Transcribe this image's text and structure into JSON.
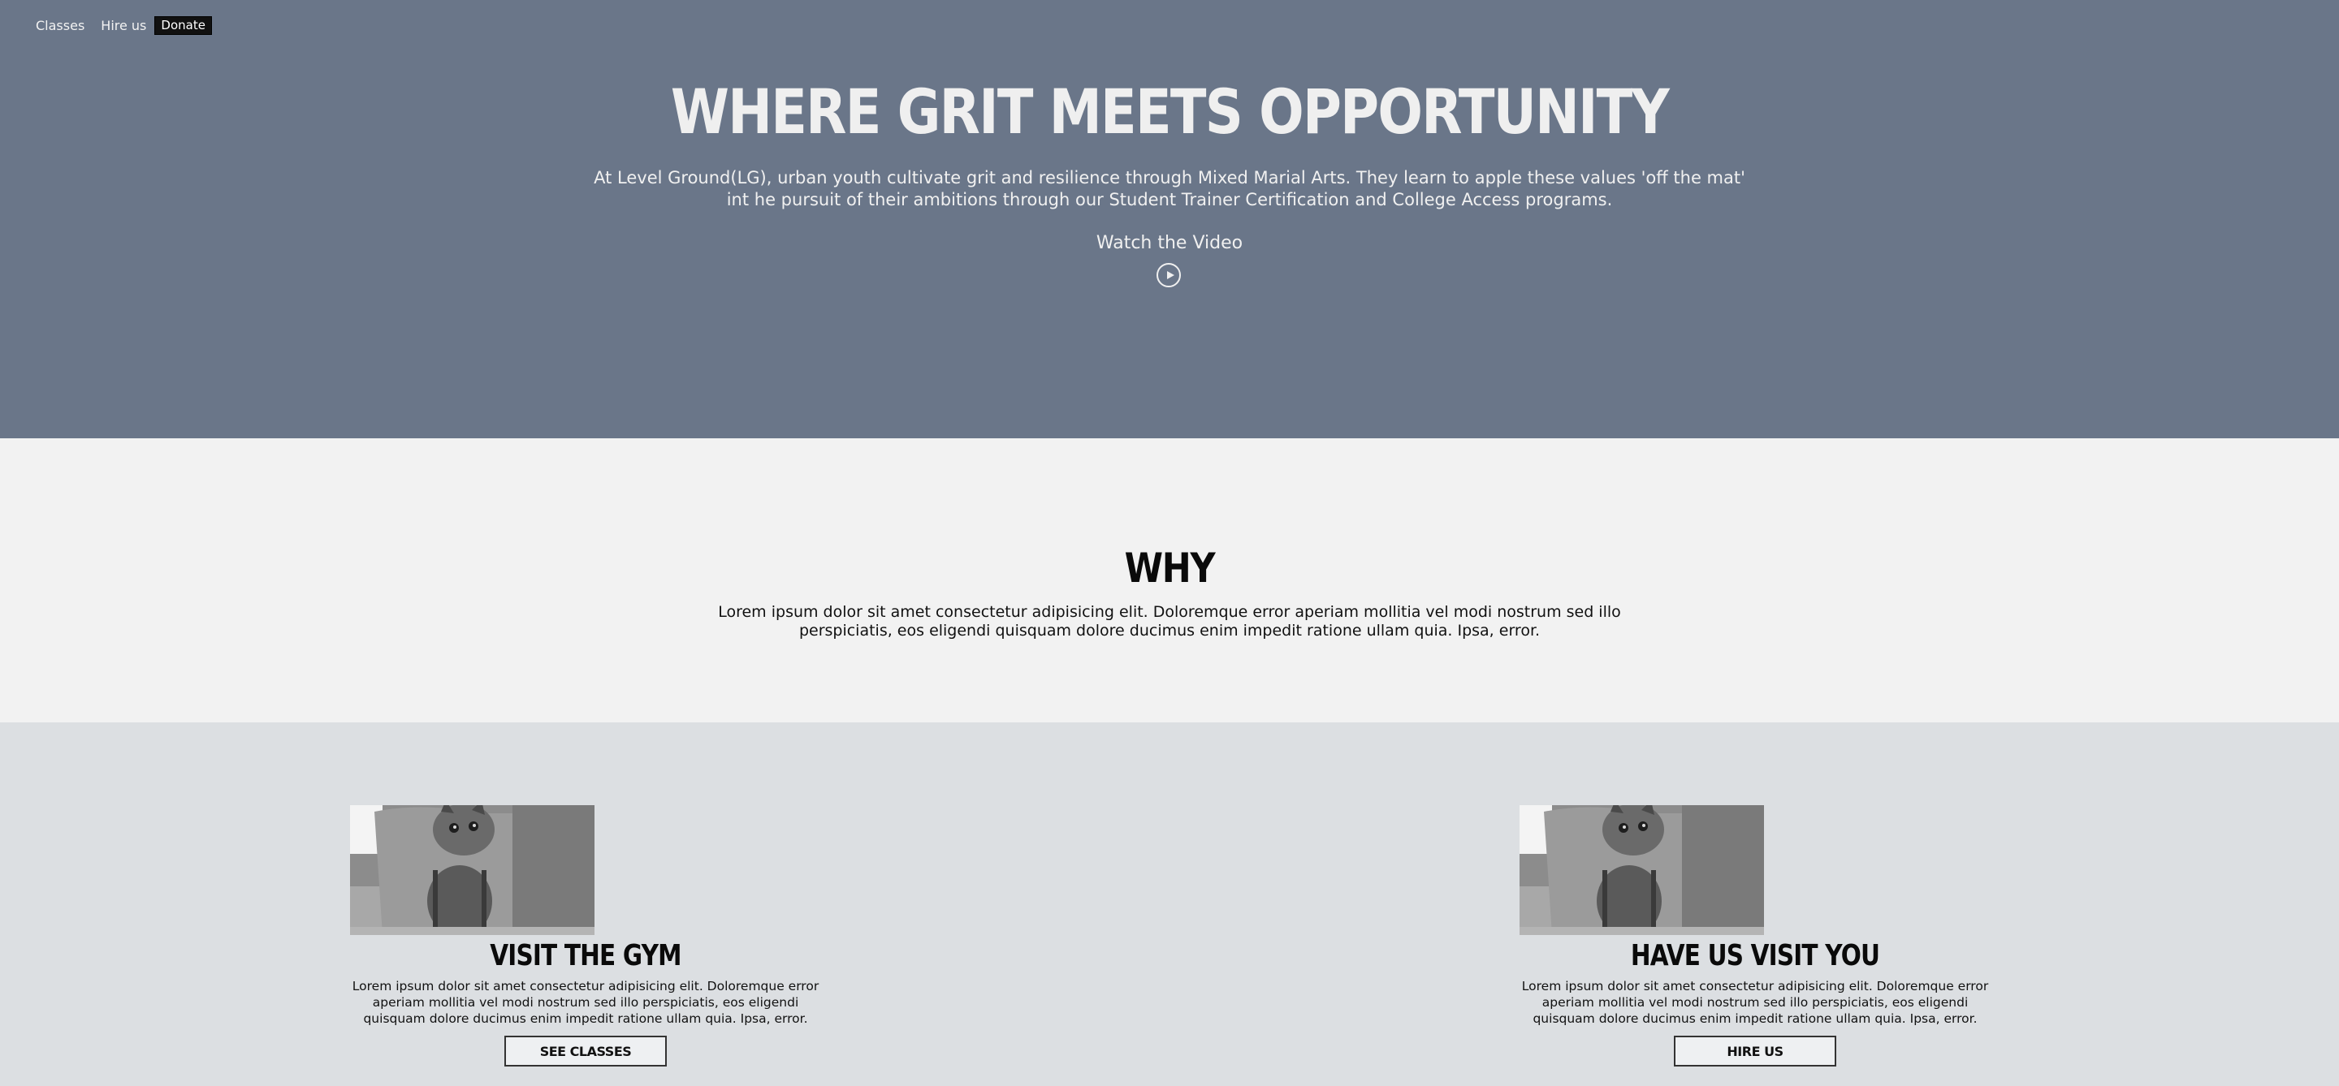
{
  "nav": {
    "items": [
      {
        "label": "Classes"
      },
      {
        "label": "Hire us"
      }
    ],
    "donate_label": "Donate"
  },
  "hero": {
    "title": "WHERE GRIT MEETS OPPORTUNITY",
    "text": "At Level Ground(LG), urban youth cultivate grit and resilience through Mixed Marial Arts. They learn to apple these values 'off the mat' int he pursuit of their ambitions through our Student Trainer Certification and College Access programs.",
    "watch_label": "Watch the Video",
    "play_icon": "play-circle-icon"
  },
  "why": {
    "title": "WHY",
    "text": "Lorem ipsum dolor sit amet consectetur adipisicing elit. Doloremque error aperiam mollitia vel modi nostrum sed illo perspiciatis, eos eligendi quisquam dolore ducimus enim impedit ratione ullam quia. Ipsa, error."
  },
  "cards": [
    {
      "title": "VISIT THE GYM",
      "text": "Lorem ipsum dolor sit amet consectetur adipisicing elit. Doloremque error aperiam mollitia vel modi nostrum sed illo perspiciatis, eos eligendi quisquam dolore ducimus enim impedit ratione ullam quia. Ipsa, error.",
      "button_label": "SEE CLASSES",
      "image": "kitten-photo"
    },
    {
      "title": "HAVE US VISIT YOU",
      "text": "Lorem ipsum dolor sit amet consectetur adipisicing elit. Doloremque error aperiam mollitia vel modi nostrum sed illo perspiciatis, eos eligendi quisquam dolore ducimus enim impedit ratione ullam quia. Ipsa, error.",
      "button_label": "HIRE US",
      "image": "kitten-photo"
    }
  ],
  "colors": {
    "hero_bg": "#6a7689",
    "why_bg": "#f2f2f2",
    "cards_bg": "#dcdfe2"
  }
}
